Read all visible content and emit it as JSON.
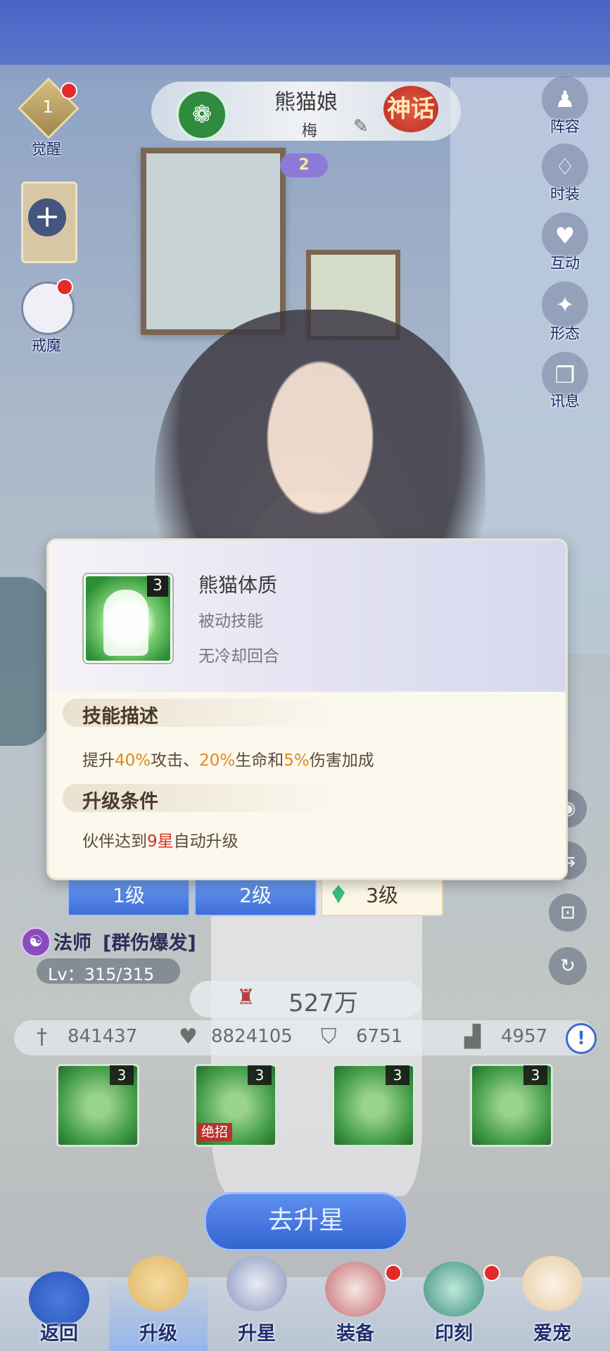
{
  "header": {
    "char_name": "熊猫娘",
    "char_sub": "梅",
    "rarity": "神话",
    "star_badge": "2",
    "faction_icon": "swirl-icon"
  },
  "left_side": {
    "awaken_level": "1",
    "awaken_label": "觉醒",
    "add_symbol": "+",
    "demon_label": "戒魔"
  },
  "right_side": {
    "items": [
      {
        "label": "阵容",
        "icon": "chess-icon",
        "glyph": "♟"
      },
      {
        "label": "时装",
        "icon": "outfit-icon",
        "glyph": "♢"
      },
      {
        "label": "互动",
        "icon": "heart-icon",
        "glyph": "♥"
      },
      {
        "label": "形态",
        "icon": "butterfly-icon",
        "glyph": "✦"
      },
      {
        "label": "讯息",
        "icon": "book-icon",
        "glyph": "❐"
      }
    ],
    "small": [
      {
        "icon": "camera-icon",
        "glyph": "◉"
      },
      {
        "icon": "share-icon",
        "glyph": "⇆"
      },
      {
        "icon": "lock-icon",
        "glyph": "⊡"
      },
      {
        "icon": "rotate-icon",
        "glyph": "↻"
      }
    ]
  },
  "popup": {
    "skill_level": "3",
    "skill_name": "熊猫体质",
    "skill_type": "被动技能",
    "skill_cd": "无冷却回合",
    "desc_title": "技能描述",
    "desc": {
      "p1": "提升",
      "v1": "40%",
      "p2": "攻击、",
      "v2": "20%",
      "p3": "生命和",
      "v3": "5%",
      "p4": "伤害加成"
    },
    "upgrade_title": "升级条件",
    "upgrade": {
      "p1": "伙伴达到",
      "v1": "9星",
      "p2": "自动升级"
    }
  },
  "level_tabs": [
    "1级",
    "2级",
    "3级"
  ],
  "class": {
    "name": "法师",
    "tag": "[群伤爆发]",
    "level": "Lv：315/315"
  },
  "power": "527万",
  "stats": {
    "attack": "841437",
    "hp": "8824105",
    "defense": "6751",
    "speed": "4957",
    "info": "!"
  },
  "skills": [
    {
      "level": "3",
      "ult": ""
    },
    {
      "level": "3",
      "ult": "绝招"
    },
    {
      "level": "3",
      "ult": ""
    },
    {
      "level": "3",
      "ult": ""
    }
  ],
  "star_button": "去升星",
  "nav": [
    {
      "label": "返回",
      "icon": "back-icon"
    },
    {
      "label": "升级",
      "icon": "levelup-icon"
    },
    {
      "label": "升星",
      "icon": "star-moon-icon"
    },
    {
      "label": "装备",
      "icon": "hat-icon"
    },
    {
      "label": "印刻",
      "icon": "hexagram-icon"
    },
    {
      "label": "爱宠",
      "icon": "cat-icon"
    }
  ],
  "colors": {
    "accent_blue": "#3f6ed8",
    "highlight_orange": "#e08a1a",
    "highlight_red": "#d63220",
    "rarity_red": "#b92b24"
  }
}
